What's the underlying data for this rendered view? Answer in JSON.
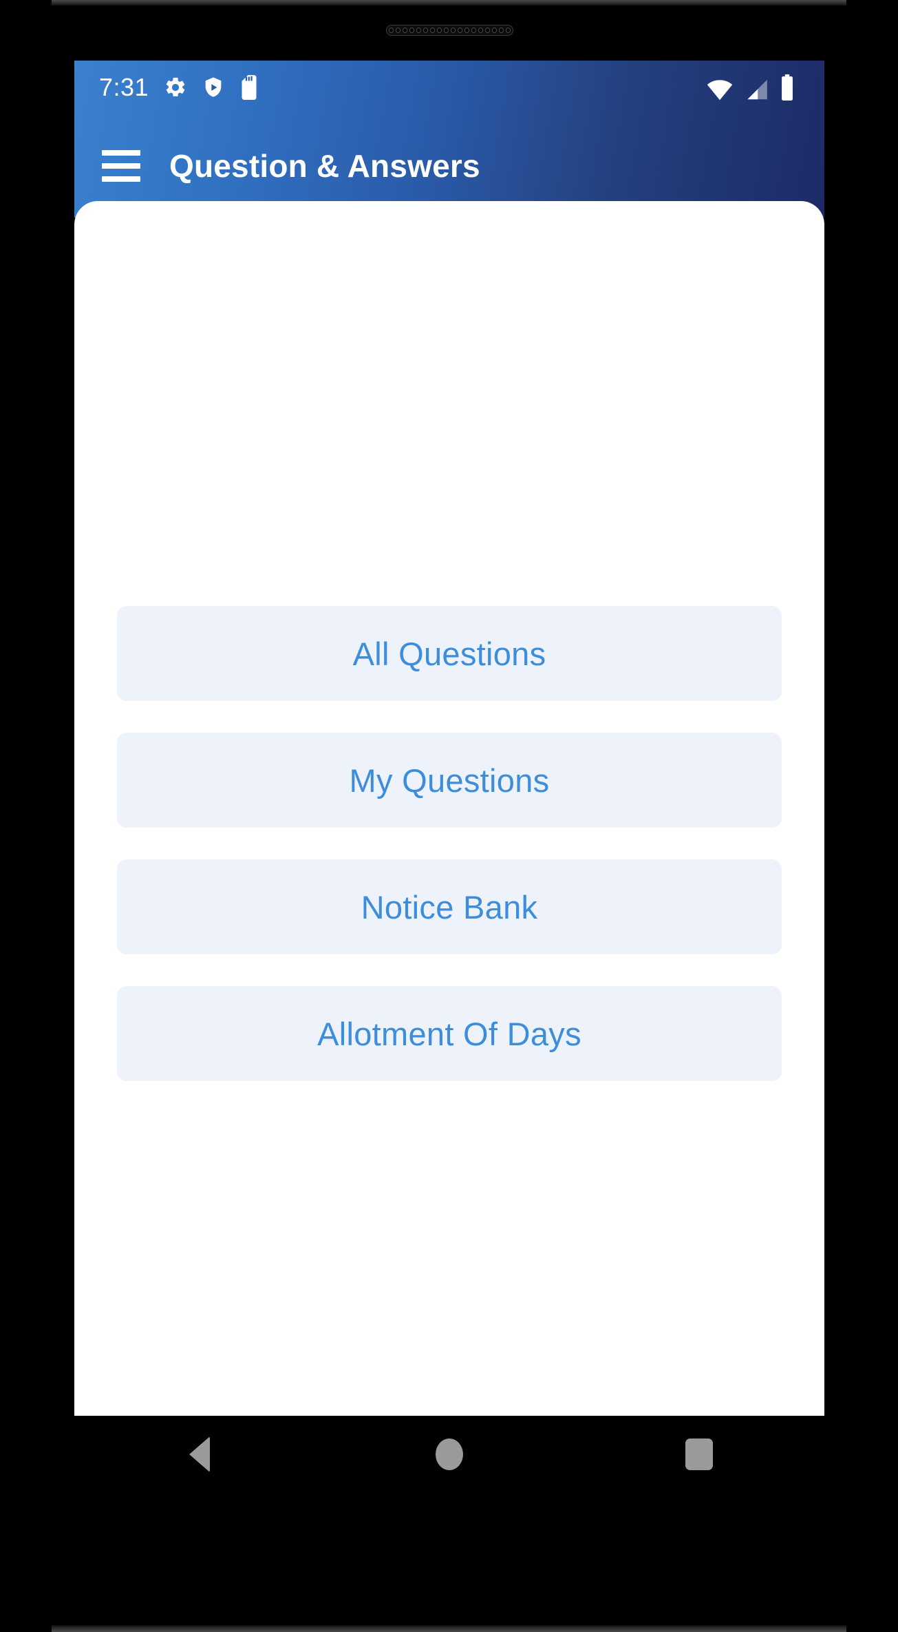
{
  "device": {
    "speaker_grille_dots": 18
  },
  "status_bar": {
    "time": "7:31",
    "left_icons": [
      "gear-icon",
      "shield-play-icon",
      "sd-card-icon"
    ],
    "right_icons": [
      "wifi-icon",
      "cell-signal-icon",
      "battery-icon"
    ]
  },
  "app_bar": {
    "menu_icon": "hamburger-menu-icon",
    "title": "Question & Answers",
    "gradient_start": "#3a81cf",
    "gradient_end": "#1d2a67"
  },
  "main": {
    "buttons": [
      {
        "label": "All Questions",
        "name": "all-questions-button"
      },
      {
        "label": "My Questions",
        "name": "my-questions-button"
      },
      {
        "label": "Notice Bank",
        "name": "notice-bank-button"
      },
      {
        "label": "Allotment Of Days",
        "name": "allotment-of-days-button"
      }
    ],
    "button_bg": "#eef2fa",
    "button_text_color": "#3d8ddd",
    "card_bg": "#ffffff"
  },
  "nav_bar": {
    "items": [
      {
        "name": "nav-back-button",
        "icon": "back-triangle-icon"
      },
      {
        "name": "nav-home-button",
        "icon": "home-circle-icon"
      },
      {
        "name": "nav-recents-button",
        "icon": "recents-square-icon"
      }
    ],
    "color": "#9a9a9a"
  }
}
